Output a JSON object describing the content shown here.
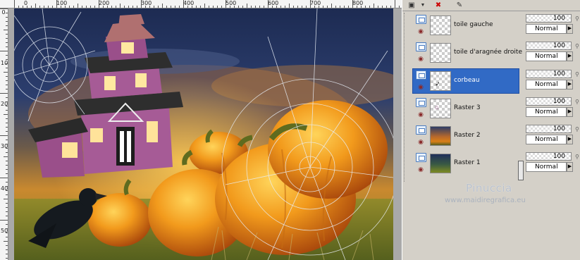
{
  "ruler": {
    "top_labels": [
      "0",
      "100",
      "200",
      "300",
      "400",
      "500",
      "600",
      "700",
      "800"
    ],
    "left_labels": [
      "0",
      "100",
      "200",
      "300",
      "400",
      "500"
    ]
  },
  "toolbar": {
    "icons": [
      "new-layer-icon",
      "dropdown-arrow-icon",
      "delete-layer-icon",
      "edit-mask-icon"
    ]
  },
  "layers": [
    {
      "name": "toile gauche",
      "opacity": "100",
      "blend": "Normal",
      "selected": false,
      "thumb": "transparent"
    },
    {
      "name": "toile d'aragnée droite",
      "opacity": "100",
      "blend": "Normal",
      "selected": false,
      "thumb": "transparent"
    },
    {
      "name": "corbeau",
      "opacity": "100",
      "blend": "Normal",
      "selected": true,
      "thumb": "crow"
    },
    {
      "name": "Raster 3",
      "opacity": "100",
      "blend": "Normal",
      "selected": false,
      "thumb": "house"
    },
    {
      "name": "Raster 2",
      "opacity": "100",
      "blend": "Normal",
      "selected": false,
      "thumb": "scene"
    },
    {
      "name": "Raster 1",
      "opacity": "100",
      "blend": "Normal",
      "selected": false,
      "thumb": "gradient"
    }
  ],
  "watermark": {
    "name": "Pinuccia",
    "url": "www.maidiregrafica.eu"
  },
  "colors": {
    "selection": "#316ac5",
    "panel": "#d4d0c8"
  }
}
